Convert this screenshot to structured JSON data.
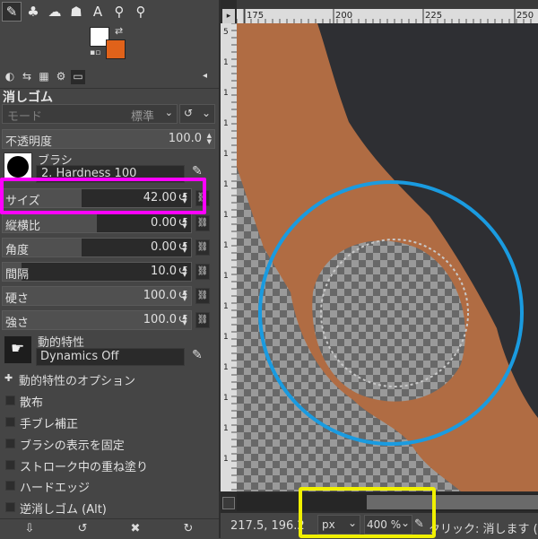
{
  "toolbox": {
    "tools": [
      {
        "icon": "eraser-icon",
        "glyph": "✎",
        "active": true
      },
      {
        "icon": "clone-stamp-icon",
        "glyph": "♣"
      },
      {
        "icon": "smudge-icon",
        "glyph": "☁"
      },
      {
        "icon": "dodge-burn-icon",
        "glyph": "☗"
      },
      {
        "icon": "text-tool-icon",
        "glyph": "A"
      },
      {
        "icon": "color-picker-icon",
        "glyph": "⚲"
      },
      {
        "icon": "zoom-icon",
        "glyph": "⚲"
      }
    ],
    "fg_color": "#ffffff",
    "bg_color": "#e0621a"
  },
  "dock_tabs": [
    {
      "icon": "tool-options-tab-icon",
      "glyph": "◐"
    },
    {
      "icon": "device-status-tab-icon",
      "glyph": "⇆"
    },
    {
      "icon": "undo-history-tab-icon",
      "glyph": "▦"
    },
    {
      "icon": "images-tab-icon",
      "glyph": "⚙"
    },
    {
      "icon": "layers-tab-icon",
      "glyph": "▭"
    }
  ],
  "tool_options": {
    "title": "消しゴム",
    "mode_label": "モード",
    "mode_value": "標準",
    "opacity_label": "不透明度",
    "opacity_value": "100.0",
    "brush_label": "ブラシ",
    "brush_name": "2. Hardness 100",
    "sliders": [
      {
        "key": "size",
        "label": "サイズ",
        "value": "42.00",
        "fill": 0.42
      },
      {
        "key": "aspect",
        "label": "縦横比",
        "value": "0.00",
        "fill": 0.5
      },
      {
        "key": "angle",
        "label": "角度",
        "value": "0.00",
        "fill": 0.42
      },
      {
        "key": "spacing",
        "label": "間隔",
        "value": "10.0",
        "fill": 0.1
      },
      {
        "key": "hardness",
        "label": "硬さ",
        "value": "100.0",
        "fill": 1.0
      },
      {
        "key": "force",
        "label": "強さ",
        "value": "100.0",
        "fill": 1.0
      }
    ],
    "dynamics_label": "動的特性",
    "dynamics_name": "Dynamics Off",
    "dynamics_options_label": "動的特性のオプション",
    "checkboxes": [
      {
        "label": "散布"
      },
      {
        "label": "手ブレ補正"
      },
      {
        "label": "ブラシの表示を固定"
      },
      {
        "label": "ストローク中の重ね塗り"
      },
      {
        "label": "ハードエッジ"
      },
      {
        "label": "逆消しゴム  (Alt)"
      }
    ]
  },
  "bottom_buttons": [
    {
      "icon": "save-options-icon",
      "glyph": "⇩"
    },
    {
      "icon": "restore-options-icon",
      "glyph": "↺"
    },
    {
      "icon": "delete-options-icon",
      "glyph": "✖"
    },
    {
      "icon": "reset-options-icon",
      "glyph": "↻"
    }
  ],
  "canvas": {
    "ruler_ticks": [
      "175",
      "200",
      "225",
      "250"
    ],
    "vertical_ruler_labels": [
      "5",
      "1",
      "1",
      "1",
      "1",
      "1",
      "1",
      "1",
      "1",
      "1",
      "1",
      "1",
      "1",
      "1",
      "1"
    ],
    "coords": "217.5, 196.2",
    "unit": "px",
    "zoom": "400 %",
    "status": "クリック: 消します (Sh"
  },
  "highlights": {
    "size_box_color": "#ff00ff",
    "zoom_box_color": "#f0f000",
    "brush_circle_color": "#1a9be0"
  }
}
